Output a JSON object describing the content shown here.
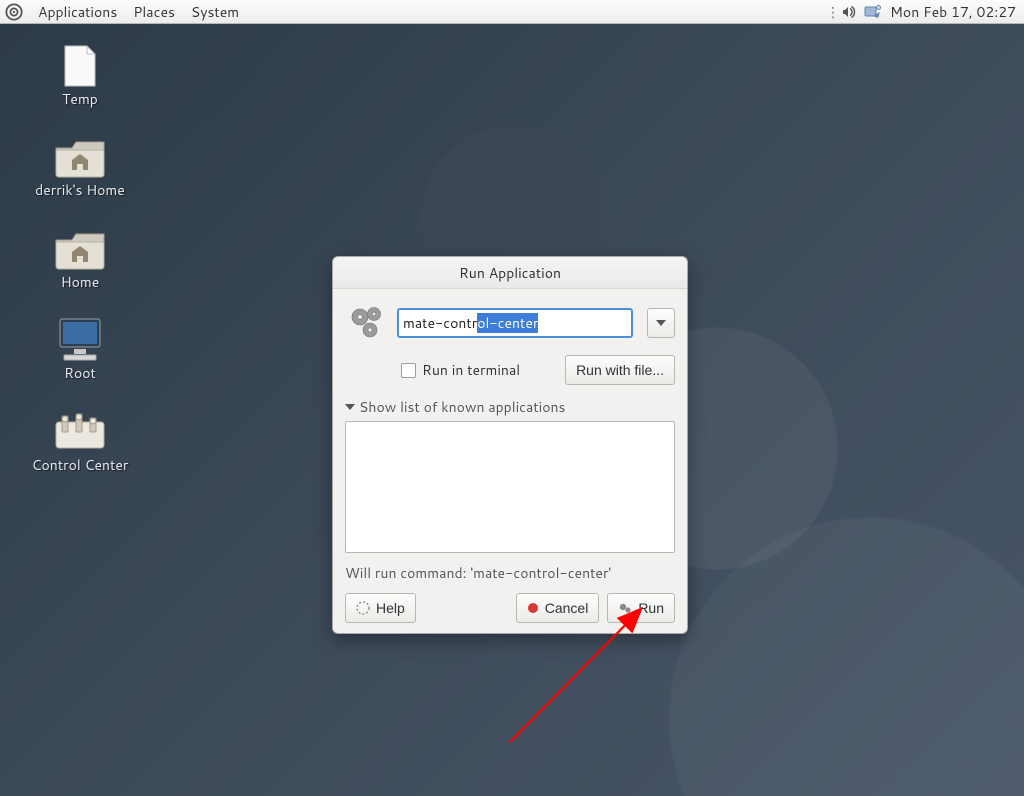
{
  "panel": {
    "menus": [
      "Applications",
      "Places",
      "System"
    ],
    "clock": "Mon Feb 17, 02:27"
  },
  "desktop": {
    "icons": [
      {
        "kind": "file",
        "label": "Temp"
      },
      {
        "kind": "folder",
        "label": "derrik's Home"
      },
      {
        "kind": "folder",
        "label": "Home"
      },
      {
        "kind": "computer",
        "label": "Root"
      },
      {
        "kind": "panel",
        "label": "Control Center"
      }
    ]
  },
  "dialog": {
    "title": "Run Application",
    "command_typed": "mate-contr",
    "command_selected": "ol-center",
    "run_in_terminal_label": "Run in terminal",
    "run_in_terminal_checked": false,
    "run_with_file_label": "Run with file...",
    "expander_label": "Show list of known applications",
    "status_text": "Will run command: 'mate-control-center'",
    "help_label": "Help",
    "cancel_label": "Cancel",
    "run_label": "Run"
  }
}
